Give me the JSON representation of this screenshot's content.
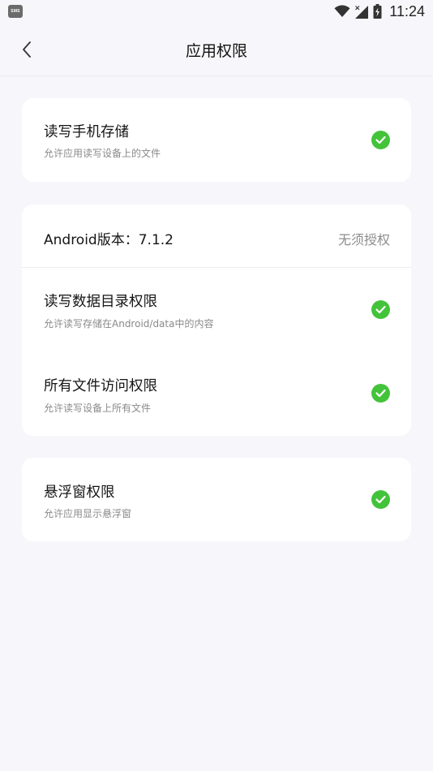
{
  "status_bar": {
    "notification_icon_text": "SMS",
    "time": "11:24",
    "icons": [
      "sms-icon",
      "wifi-icon",
      "cellular-signal-icon",
      "battery-charging-icon"
    ]
  },
  "header": {
    "title": "应用权限",
    "back_icon": "chevron-left-icon"
  },
  "storage_card": {
    "title": "读写手机存储",
    "subtitle": "允许应用读写设备上的文件",
    "granted": true
  },
  "android_card": {
    "version_label": "Android版本：7.1.2",
    "version_status": "无须授权",
    "items": [
      {
        "title": "读写数据目录权限",
        "subtitle": "允许读写存储在Android/data中的内容",
        "granted": true
      },
      {
        "title": "所有文件访问权限",
        "subtitle": "允许读写设备上所有文件",
        "granted": true
      }
    ]
  },
  "overlay_card": {
    "title": "悬浮窗权限",
    "subtitle": "允许应用显示悬浮窗",
    "granted": true
  },
  "colors": {
    "background": "#f7f7fb",
    "card": "#ffffff",
    "check_green": "#43c33a",
    "secondary_text": "#8a8a8a"
  }
}
